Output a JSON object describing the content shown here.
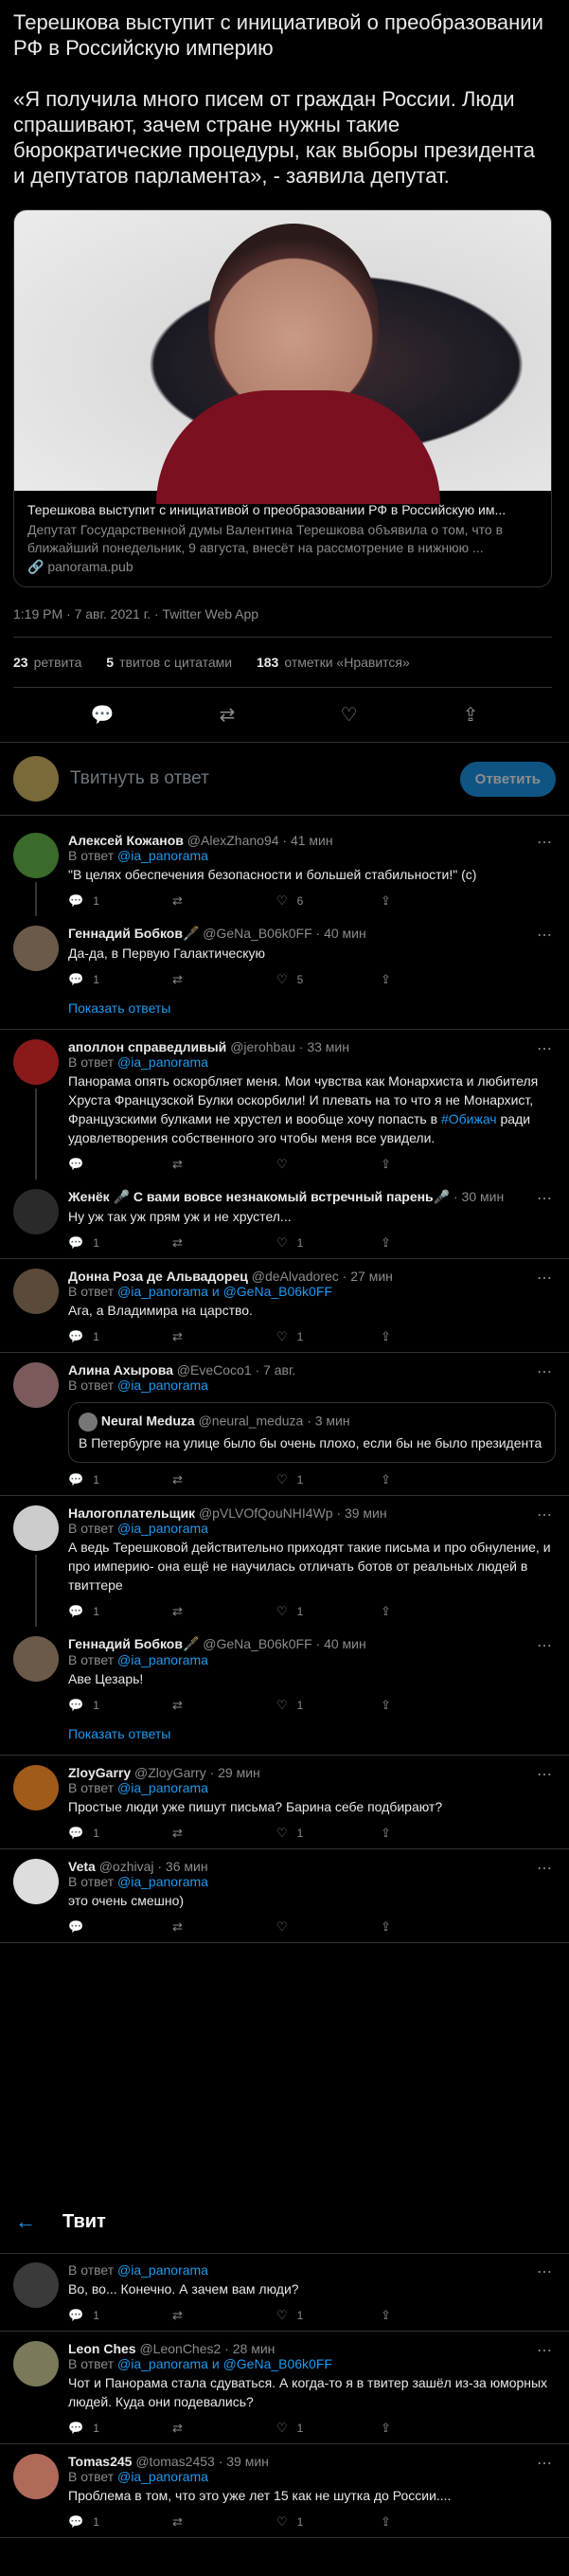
{
  "tweet": {
    "text": "Терешкова выступит с инициативой о преобразовании РФ в Российскую империю\n\n«Я получила много писем от граждан России. Люди спрашивают, зачем стране нужны такие бюрократические процедуры, как выборы президента и депутатов парламента», - заявила депутат.",
    "card_title": "Терешкова выступит с инициативой о преобразовании РФ в Российскую им...",
    "card_desc": "Депутат Государственной думы Валентина Терешкова объявила о том, что в ближайший понедельник, 9 августа, внесёт на рассмотрение в нижнюю ...",
    "card_domain": "🔗 panorama.pub",
    "meta": "1:19 PM · 7 авг. 2021 г. · Twitter Web App",
    "retweets": "23",
    "retweets_label": "ретвита",
    "quotes": "5",
    "quotes_label": "твитов с цитатами",
    "likes": "183",
    "likes_label": "отметки «Нравится»"
  },
  "reply_placeholder": "Твитнуть в ответ",
  "reply_button": "Ответить",
  "top_bar": {
    "back": "←",
    "title": "Твит"
  },
  "show_replies": "Показать ответы",
  "replies": [
    {
      "name": "Алексей Кожанов",
      "handle": "@AlexZhano94 · 41 мин",
      "rt": "В ответ",
      "rt_m": "@ia_panorama",
      "text": "\"В целях обеспечения безопасности и большей стабильности!\" (с)",
      "reply": "1",
      "like": "6",
      "color": "#3a6b2a"
    },
    {
      "name": "Геннадий Бобков🖋️",
      "handle": "@GeNa_B06k0FF · 40 мин",
      "text": "Да-да, в Первую Галактическую",
      "reply": "1",
      "like": "5",
      "color": "#6b5a4a"
    },
    {
      "name": "аполлон справедливый",
      "handle": "@jerohbau · 33 мин",
      "rt": "В ответ",
      "rt_m": "@ia_panorama",
      "text": "Панорама опять оскорбляет меня. Мои чувства как Монархиста и любителя Хруста Французской Булки оскорбили! И плевать на то что я не Монархист, Французскими булками не хрустел и вообще хочу попасть в",
      "text_m": "#Обижач",
      "text2": "ради удовлетворения собственного эго чтобы меня все увидели.",
      "color": "#8a1a1a"
    },
    {
      "name": "Женёк 🎤 С вами вовсе незнакомый встречный парень🎤",
      "handle": "· 30 мин",
      "text": "Ну уж так уж прям уж и не хрустел...",
      "reply": "1",
      "like": "1",
      "color": "#2a2a2a"
    },
    {
      "name": "Донна Роза де Альвадорец",
      "handle": "@deAlvadorec · 27 мин",
      "rt": "В ответ",
      "rt_m": "@ia_panorama и @GeNa_B06k0FF",
      "text": "Ага, а Владимира на царство.",
      "reply": "1",
      "like": "1",
      "color": "#5a4a3a"
    },
    {
      "name": "Алина Ахырова",
      "handle": "@EveCoco1 · 7 авг.",
      "rt": "В ответ",
      "rt_m": "@ia_panorama",
      "quote_name": "Neural Meduza",
      "quote_handle": "@neural_meduza · 3 мин",
      "quote_text": "В Петербурге на улице было бы очень плохо, если бы не было президента",
      "reply": "1",
      "like": "1",
      "color": "#7a5a5a"
    },
    {
      "name": "Налогоплательщик",
      "handle": "@pVLVOfQouNHI4Wp · 39 мин",
      "rt": "В ответ",
      "rt_m": "@ia_panorama",
      "text": "А ведь Терешковой действительно приходят такие письма и про обнуление, и про империю- она ещё не научилась отличать ботов от реальных людей в твиттере",
      "reply": "1",
      "like": "1",
      "color": "#cccccc"
    },
    {
      "name": "Геннадий Бобков🖋️",
      "handle": "@GeNa_B06k0FF · 40 мин",
      "rt": "В ответ",
      "rt_m": "@ia_panorama",
      "text": "Аве Цезарь!",
      "reply": "1",
      "like": "1",
      "color": "#6b5a4a"
    },
    {
      "name": "ZloyGarry",
      "handle": "@ZloyGarry · 29 мин",
      "rt": "В ответ",
      "rt_m": "@ia_panorama",
      "text": "Простые люди уже пишут письма? Барина себе подбирают?",
      "reply": "1",
      "like": "1",
      "color": "#a05a1a"
    },
    {
      "name": "Veta",
      "handle": "@ozhivaj · 36 мин",
      "rt": "В ответ",
      "rt_m": "@ia_panorama",
      "text": "это очень смешно)",
      "color": "#dddddd"
    }
  ],
  "replies_bottom": [
    {
      "name": "",
      "handle": "",
      "rt": "В ответ",
      "rt_m": "@ia_panorama",
      "text": "Во, во... Конечно. А зачем вам люди?",
      "reply": "1",
      "like": "1",
      "color": "#3a3a3a"
    },
    {
      "name": "Leon Ches",
      "handle": "@LeonChes2 · 28 мин",
      "rt": "В ответ",
      "rt_m": "@ia_panorama и @GeNa_B06k0FF",
      "text": "Чот и Панорама стала сдуваться. А когда-то я в твитер зашёл из-за юморных людей.  Куда они подевались?",
      "reply": "1",
      "like": "1",
      "color": "#7a7a5a"
    },
    {
      "name": "Tomas245",
      "handle": "@tomas2453 · 39 мин",
      "rt": "В ответ",
      "rt_m": "@ia_panorama",
      "text": "Проблема в том, что это уже лет 15 как не шутка до России....",
      "reply": "1",
      "like": "1",
      "color": "#b06a5a"
    }
  ]
}
